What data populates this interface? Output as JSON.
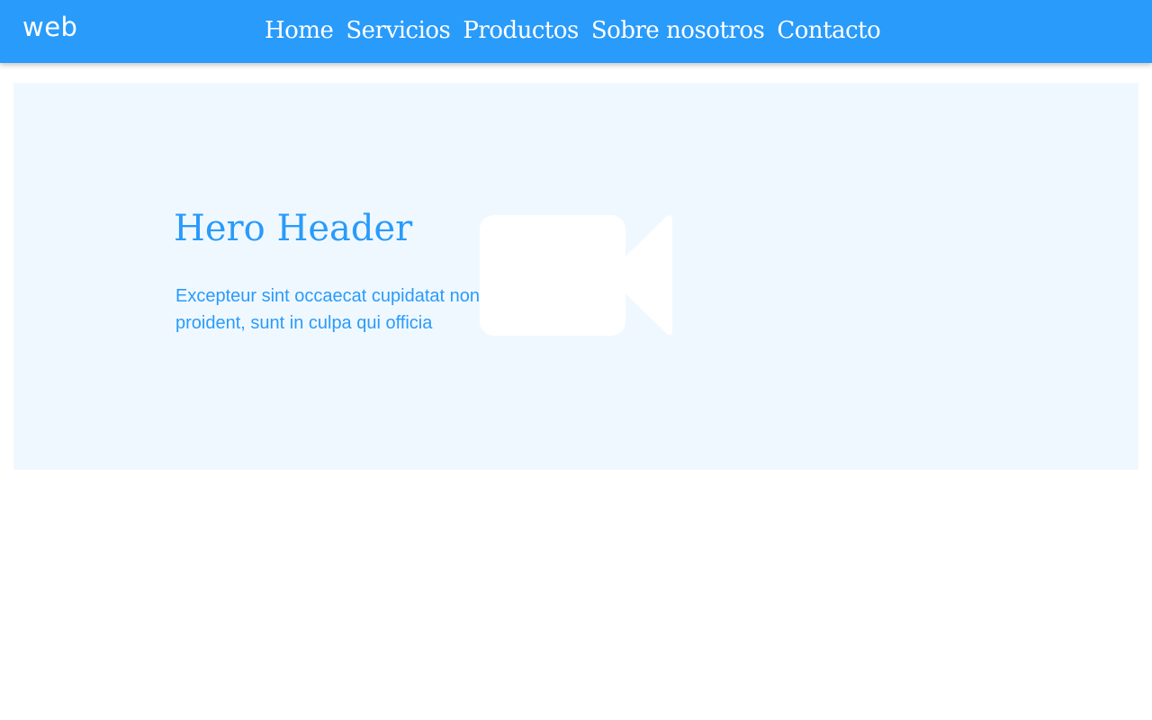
{
  "navbar": {
    "brand": "web",
    "items": [
      {
        "label": "Home"
      },
      {
        "label": "Servicios"
      },
      {
        "label": "Productos"
      },
      {
        "label": "Sobre nosotros"
      },
      {
        "label": "Contacto"
      }
    ],
    "background_color": "#299bfb",
    "text_color": "#ffffff"
  },
  "hero": {
    "title": "Hero Header",
    "text": "Excepteur sint occaecat cupidatat non proident, sunt in culpa qui officia",
    "icon": "video-camera-icon",
    "background_color": "#f0f8ff",
    "accent_color": "#299bfb"
  }
}
